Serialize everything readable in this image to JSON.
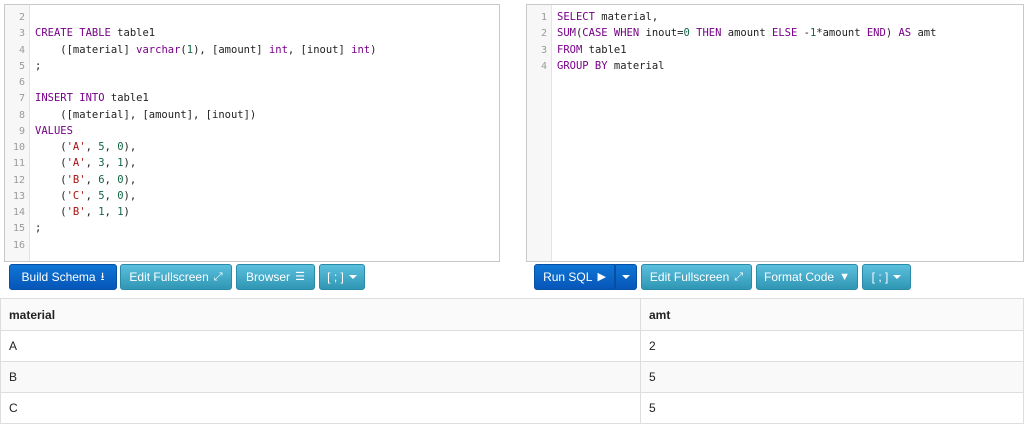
{
  "schema_editor": {
    "lines": [
      {
        "n": "2",
        "segs": []
      },
      {
        "n": "3",
        "segs": [
          {
            "t": "CREATE TABLE",
            "c": "kw"
          },
          {
            "t": " table1",
            "c": ""
          }
        ]
      },
      {
        "n": "4",
        "segs": [
          {
            "t": "    ([material] ",
            "c": ""
          },
          {
            "t": "varchar",
            "c": "kw"
          },
          {
            "t": "(",
            "c": ""
          },
          {
            "t": "1",
            "c": "num"
          },
          {
            "t": "), [amount] ",
            "c": ""
          },
          {
            "t": "int",
            "c": "kw"
          },
          {
            "t": ", [inout] ",
            "c": ""
          },
          {
            "t": "int",
            "c": "kw"
          },
          {
            "t": ")",
            "c": ""
          }
        ]
      },
      {
        "n": "5",
        "segs": [
          {
            "t": ";",
            "c": ""
          }
        ]
      },
      {
        "n": "6",
        "segs": []
      },
      {
        "n": "7",
        "segs": [
          {
            "t": "INSERT INTO",
            "c": "kw"
          },
          {
            "t": " table1",
            "c": ""
          }
        ]
      },
      {
        "n": "8",
        "segs": [
          {
            "t": "    ([material], [amount], [inout])",
            "c": ""
          }
        ]
      },
      {
        "n": "9",
        "segs": [
          {
            "t": "VALUES",
            "c": "kw"
          }
        ]
      },
      {
        "n": "10",
        "segs": [
          {
            "t": "    (",
            "c": ""
          },
          {
            "t": "'A'",
            "c": "str"
          },
          {
            "t": ", ",
            "c": ""
          },
          {
            "t": "5",
            "c": "num"
          },
          {
            "t": ", ",
            "c": ""
          },
          {
            "t": "0",
            "c": "num"
          },
          {
            "t": "),",
            "c": ""
          }
        ]
      },
      {
        "n": "11",
        "segs": [
          {
            "t": "    (",
            "c": ""
          },
          {
            "t": "'A'",
            "c": "str"
          },
          {
            "t": ", ",
            "c": ""
          },
          {
            "t": "3",
            "c": "num"
          },
          {
            "t": ", ",
            "c": ""
          },
          {
            "t": "1",
            "c": "num"
          },
          {
            "t": "),",
            "c": ""
          }
        ]
      },
      {
        "n": "12",
        "segs": [
          {
            "t": "    (",
            "c": ""
          },
          {
            "t": "'B'",
            "c": "str"
          },
          {
            "t": ", ",
            "c": ""
          },
          {
            "t": "6",
            "c": "num"
          },
          {
            "t": ", ",
            "c": ""
          },
          {
            "t": "0",
            "c": "num"
          },
          {
            "t": "),",
            "c": ""
          }
        ]
      },
      {
        "n": "13",
        "segs": [
          {
            "t": "    (",
            "c": ""
          },
          {
            "t": "'C'",
            "c": "str"
          },
          {
            "t": ", ",
            "c": ""
          },
          {
            "t": "5",
            "c": "num"
          },
          {
            "t": ", ",
            "c": ""
          },
          {
            "t": "0",
            "c": "num"
          },
          {
            "t": "),",
            "c": ""
          }
        ]
      },
      {
        "n": "14",
        "segs": [
          {
            "t": "    (",
            "c": ""
          },
          {
            "t": "'B'",
            "c": "str"
          },
          {
            "t": ", ",
            "c": ""
          },
          {
            "t": "1",
            "c": "num"
          },
          {
            "t": ", ",
            "c": ""
          },
          {
            "t": "1",
            "c": "num"
          },
          {
            "t": ")",
            "c": ""
          }
        ]
      },
      {
        "n": "15",
        "segs": [
          {
            "t": ";",
            "c": ""
          }
        ]
      },
      {
        "n": "16",
        "segs": []
      }
    ]
  },
  "query_editor": {
    "lines": [
      {
        "n": "1",
        "segs": [
          {
            "t": "SELECT",
            "c": "kw"
          },
          {
            "t": " material,",
            "c": ""
          }
        ]
      },
      {
        "n": "2",
        "segs": [
          {
            "t": "SUM",
            "c": "kw"
          },
          {
            "t": "(",
            "c": ""
          },
          {
            "t": "CASE WHEN",
            "c": "kw"
          },
          {
            "t": " inout=",
            "c": ""
          },
          {
            "t": "0",
            "c": "num"
          },
          {
            "t": " ",
            "c": ""
          },
          {
            "t": "THEN",
            "c": "kw"
          },
          {
            "t": " amount ",
            "c": ""
          },
          {
            "t": "ELSE",
            "c": "kw"
          },
          {
            "t": " -",
            "c": ""
          },
          {
            "t": "1",
            "c": "num"
          },
          {
            "t": "*amount ",
            "c": ""
          },
          {
            "t": "END",
            "c": "kw"
          },
          {
            "t": ") ",
            "c": ""
          },
          {
            "t": "AS",
            "c": "kw"
          },
          {
            "t": " amt",
            "c": ""
          }
        ]
      },
      {
        "n": "3",
        "segs": [
          {
            "t": "FROM",
            "c": "kw"
          },
          {
            "t": " table1",
            "c": ""
          }
        ]
      },
      {
        "n": "4",
        "segs": [
          {
            "t": "GROUP BY",
            "c": "kw"
          },
          {
            "t": " material",
            "c": ""
          }
        ]
      }
    ]
  },
  "toolbar_left": {
    "build_schema": "Build Schema",
    "edit_fullscreen": "Edit Fullscreen",
    "browser": "Browser",
    "terminator": "[ ; ]"
  },
  "toolbar_right": {
    "run_sql": "Run SQL",
    "edit_fullscreen": "Edit Fullscreen",
    "format_code": "Format Code",
    "terminator": "[ ; ]"
  },
  "icons": {
    "build_schema": "download-icon",
    "edit_fullscreen": "expand-icon",
    "browser": "tree-icon",
    "run_sql": "play-icon",
    "format_code": "filter-icon",
    "dropdown": "caret-down-icon"
  },
  "colors": {
    "primary": "#0a67c9",
    "info": "#46acd0",
    "keyword": "#770088",
    "string": "#aa1111",
    "number": "#116644"
  },
  "results": {
    "columns": [
      "material",
      "amt"
    ],
    "rows": [
      [
        "A",
        "2"
      ],
      [
        "B",
        "5"
      ],
      [
        "C",
        "5"
      ]
    ]
  }
}
